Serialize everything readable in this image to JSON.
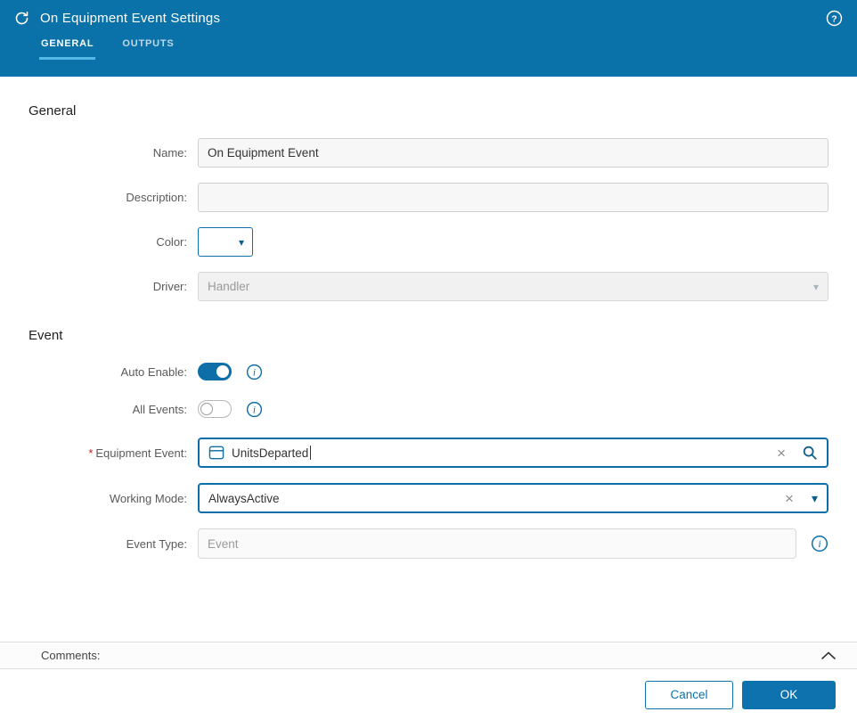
{
  "header": {
    "title": "On Equipment Event Settings"
  },
  "tabs": {
    "general": "GENERAL",
    "outputs": "OUTPUTS"
  },
  "general": {
    "heading": "General",
    "name_label": "Name:",
    "name_value": "On Equipment Event",
    "description_label": "Description:",
    "description_value": "",
    "color_label": "Color:",
    "driver_label": "Driver:",
    "driver_placeholder": "Handler"
  },
  "event": {
    "heading": "Event",
    "auto_enable_label": "Auto Enable:",
    "auto_enable_on": true,
    "all_events_label": "All Events:",
    "all_events_on": false,
    "equipment_event_required": "*",
    "equipment_event_label": "Equipment Event:",
    "equipment_event_value": "UnitsDeparted",
    "working_mode_label": "Working Mode:",
    "working_mode_value": "AlwaysActive",
    "event_type_label": "Event Type:",
    "event_type_placeholder": "Event"
  },
  "comments": {
    "label": "Comments:"
  },
  "footer": {
    "cancel": "Cancel",
    "ok": "OK"
  },
  "colors": {
    "header_blue": "#0a72a9",
    "accent_blue": "#0d6ea8",
    "tab_underline": "#55b8e6",
    "ok_button": "#0d72ad",
    "required_red": "#c21a1a"
  }
}
